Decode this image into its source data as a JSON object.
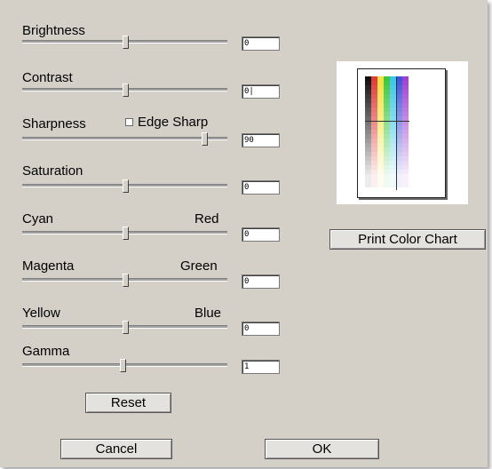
{
  "sliders": [
    {
      "id": "brightness",
      "label": "Brightness",
      "value_text": "0",
      "level": 0
    },
    {
      "id": "contrast",
      "label": "Contrast",
      "value_text": "0|",
      "level": 0
    },
    {
      "id": "sharpness",
      "label": "Sharpness",
      "value_text": "90",
      "level": 90
    },
    {
      "id": "saturation",
      "label": "Saturation",
      "value_text": "0",
      "level": 0
    },
    {
      "id": "cyan-red",
      "label": "Cyan",
      "right_label": "Red",
      "value_text": "0",
      "level": 0
    },
    {
      "id": "magenta-green",
      "label": "Magenta",
      "right_label": "Green",
      "value_text": "0",
      "level": 0
    },
    {
      "id": "yellow-blue",
      "label": "Yellow",
      "right_label": "Blue",
      "value_text": "0",
      "level": 0
    },
    {
      "id": "gamma",
      "label": "Gamma",
      "value_text": "1",
      "level": 1
    }
  ],
  "edge_sharp": {
    "label": "Edge Sharp",
    "checked": false
  },
  "buttons": {
    "print_chart": "Print Color Chart",
    "reset": "Reset",
    "cancel": "Cancel",
    "ok": "OK"
  },
  "colors": {
    "dialog_bg": "#d4d0c8",
    "chart_columns": [
      "#111111",
      "#e23a3a",
      "#f5e23a",
      "#3fc63f",
      "#38c7e8",
      "#3a55dd",
      "#a23fcf"
    ]
  }
}
